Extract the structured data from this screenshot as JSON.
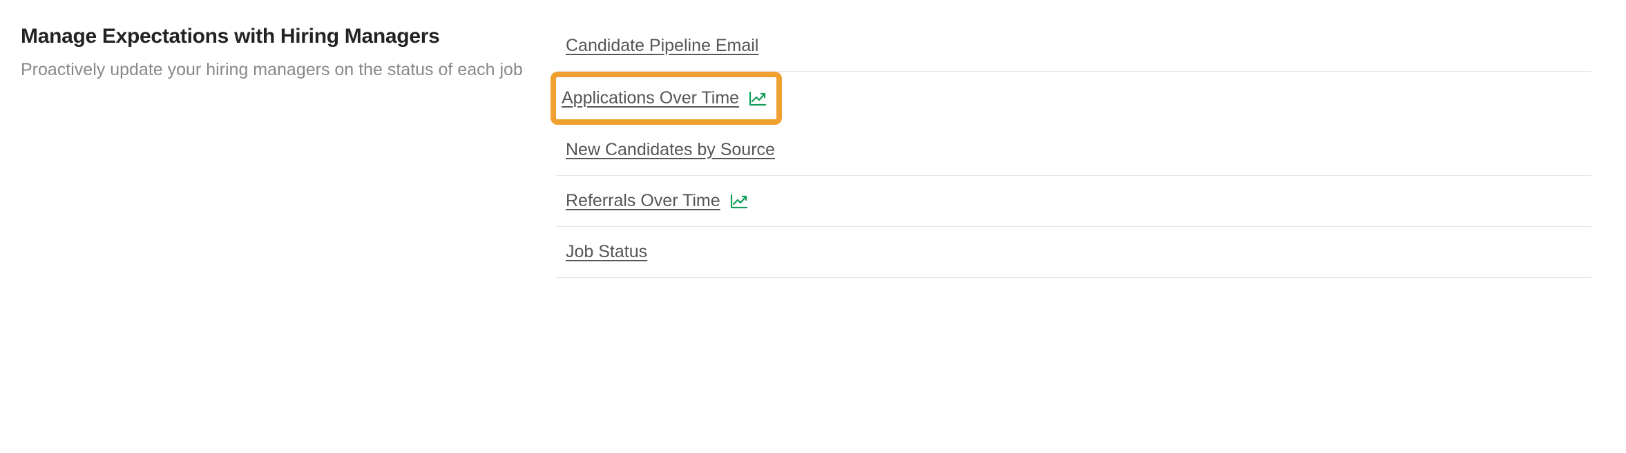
{
  "section": {
    "title": "Manage Expectations with Hiring Managers",
    "subtitle": "Proactively update your hiring managers on the status of each job"
  },
  "reports": [
    {
      "label": "Candidate Pipeline Email",
      "has_chart_icon": false,
      "highlighted": false
    },
    {
      "label": "Applications Over Time",
      "has_chart_icon": true,
      "highlighted": true
    },
    {
      "label": "New Candidates by Source",
      "has_chart_icon": false,
      "highlighted": false
    },
    {
      "label": "Referrals Over Time",
      "has_chart_icon": true,
      "highlighted": false
    },
    {
      "label": "Job Status",
      "has_chart_icon": false,
      "highlighted": false
    }
  ],
  "colors": {
    "highlight_border": "#f0a030",
    "icon_color": "#0f9d58",
    "link_color": "#555555",
    "subtitle_color": "#888888"
  }
}
